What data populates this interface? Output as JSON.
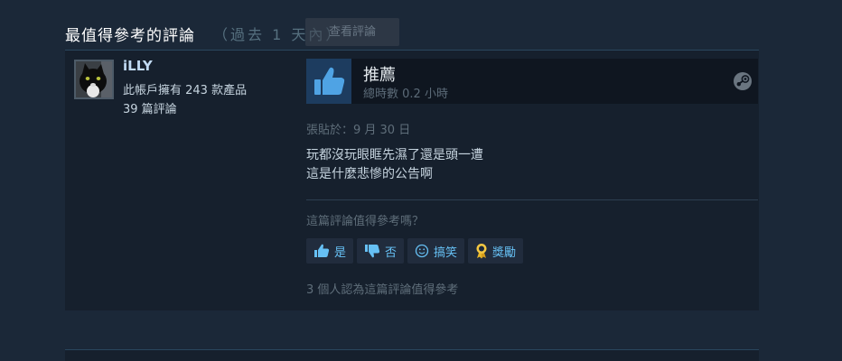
{
  "section": {
    "title": "最值得參考的評論",
    "period": "（過去 1 天內）",
    "ghost_button_label": "查看評論"
  },
  "review": {
    "author": {
      "name": "iLLY",
      "owned_games": "此帳戶擁有 243 款產品",
      "review_count": "39 篇評論"
    },
    "verdict": "推薦",
    "hours": "總時數 0.2 小時",
    "posted": "張貼於：9 月 30 日",
    "body_lines": [
      "玩都沒玩眼眶先濕了還是頭一遭",
      "這是什麼悲慘的公告啊"
    ],
    "helpful_question": "這篇評論值得參考嗎？",
    "buttons": {
      "yes": "是",
      "no": "否",
      "funny": "搞笑",
      "award": "獎勵"
    },
    "helpful_count": "3 個人認為這篇評論值得參考"
  },
  "colors": {
    "background": "#1b2838",
    "card": "#16202d",
    "accent": "#66c0f4",
    "thumb_bg": "#1d3c5f",
    "thumb_fg": "#4fa3e4"
  },
  "icons": {
    "avatar": "black-cat-avatar",
    "recommend": "thumbs-up-icon",
    "steam": "steam-logo-icon",
    "yes": "thumbs-up-icon",
    "no": "thumbs-down-icon",
    "funny": "smiley-icon",
    "award": "award-medal-icon"
  }
}
